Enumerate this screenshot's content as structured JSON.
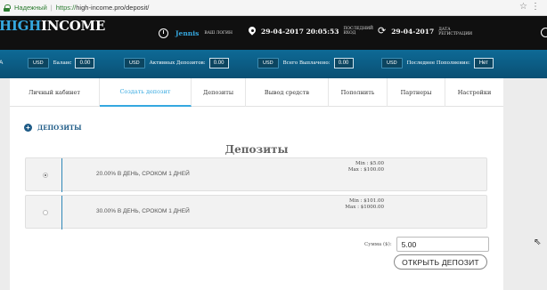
{
  "browser": {
    "secure_label": "Надежный",
    "url_protocol": "https://",
    "url_rest": "high-income.pro/deposit/"
  },
  "header": {
    "logo_high": "HIGH",
    "logo_income": "INCOME",
    "username": "Jennis",
    "username_caption": "ВАШ ЛОГИН",
    "last_login_datetime": "29-04-2017 20:05:53",
    "last_login_caption": "ПОСЛЕДНИЙ ВХОД",
    "registration_date": "29-04-2017",
    "registration_caption": "ДАТА РЕГИСТРАЦИИ"
  },
  "stats": {
    "edge_label": "A",
    "items": [
      {
        "currency": "USD",
        "label": "Баланс",
        "value": "0.00"
      },
      {
        "currency": "USD",
        "label": "Активных Депозитов:",
        "value": "0.00"
      },
      {
        "currency": "USD",
        "label": "Всего Выплачено:",
        "value": "0.00"
      },
      {
        "currency": "USD",
        "label": "Последнее Пополнение:",
        "value": "Нет"
      }
    ]
  },
  "tabs": [
    {
      "label": "Личный кабинет"
    },
    {
      "label": "Создать депозит"
    },
    {
      "label": "Депозиты"
    },
    {
      "label": "Вывод средств"
    },
    {
      "label": "Пополнить"
    },
    {
      "label": "Партнеры"
    },
    {
      "label": "Настройки"
    }
  ],
  "section": {
    "title": "ДЕПОЗИТЫ",
    "heading": "Депозиты"
  },
  "plans": [
    {
      "name": "20.00% В ДЕНЬ, СРОКОМ 1 ДНЕЙ",
      "min": "Min : $5.00",
      "max": "Max : $100.00",
      "selected": true
    },
    {
      "name": "30.00% В ДЕНЬ, СРОКОМ 1 ДНЕЙ",
      "min": "Min : $101.00",
      "max": "Max : $1000.00",
      "selected": false
    }
  ],
  "form": {
    "sum_label": "Сумма ($):",
    "sum_value": "5.00",
    "submit_label": "ОТКРЫТЬ ДЕПОЗИТ"
  },
  "colors": {
    "accent": "#35a8e0",
    "header_bg": "#101010",
    "stats_bg": "#0e6a96",
    "section_title": "#1d5a86"
  }
}
